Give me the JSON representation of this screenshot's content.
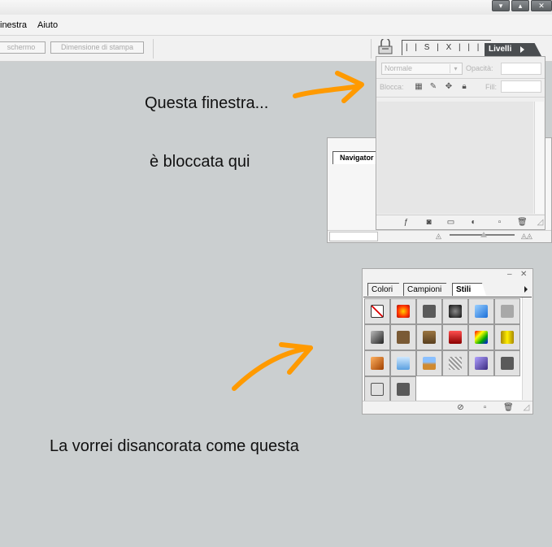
{
  "menu": {
    "items": [
      "inestra",
      "Aiuto"
    ]
  },
  "options_bar": {
    "buttons": [
      "schermo",
      "Dimensione di stampa"
    ]
  },
  "layers_palette": {
    "ruler_tabs_text": "| | S | X | | | | F | |",
    "tab_label": "Livelli",
    "blend_mode": "Normale",
    "opacity_label": "Opacità:",
    "lock_label": "Blocca:",
    "fill_label": "Fill:"
  },
  "navigator_palette": {
    "tab_label": "Navigator"
  },
  "styles_palette": {
    "tabs": [
      "Colori",
      "Campioni",
      "Stili"
    ],
    "active_tab": "Stili",
    "swatch_count": 20
  },
  "annotations": {
    "note1": "Questa finestra...",
    "note2": "è bloccata qui",
    "note3": "La vorrei disancorata come questa"
  },
  "colors": {
    "background": "#cbcfd0",
    "arrow": "#ff9a00",
    "tab_dark": "#4a4d50"
  }
}
